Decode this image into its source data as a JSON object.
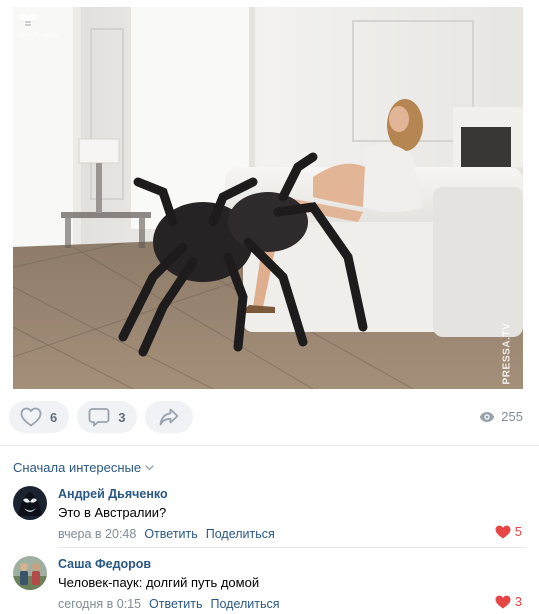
{
  "post": {
    "image_watermark_logo": "OKA'S OKES",
    "image_watermark_side": "PRESSA.TV"
  },
  "actions": {
    "likes": "6",
    "comments": "3",
    "views": "255"
  },
  "comments_section": {
    "sort_label": "Сначала интересные"
  },
  "comments": [
    {
      "author": "Андрей Дьяченко",
      "text": "Это в Австралии?",
      "time": "вчера в 20:48",
      "reply": "Ответить",
      "share": "Поделиться",
      "likes": "5"
    },
    {
      "author": "Саша Федоров",
      "text": "Человек-паук: долгий путь домой",
      "time": "сегодня в 0:15",
      "reply": "Ответить",
      "share": "Поделиться",
      "likes": "3"
    }
  ],
  "colors": {
    "link": "#2a5885",
    "muted": "#818c99",
    "pill_bg": "#f0f2f5",
    "like_red": "#e64646"
  }
}
